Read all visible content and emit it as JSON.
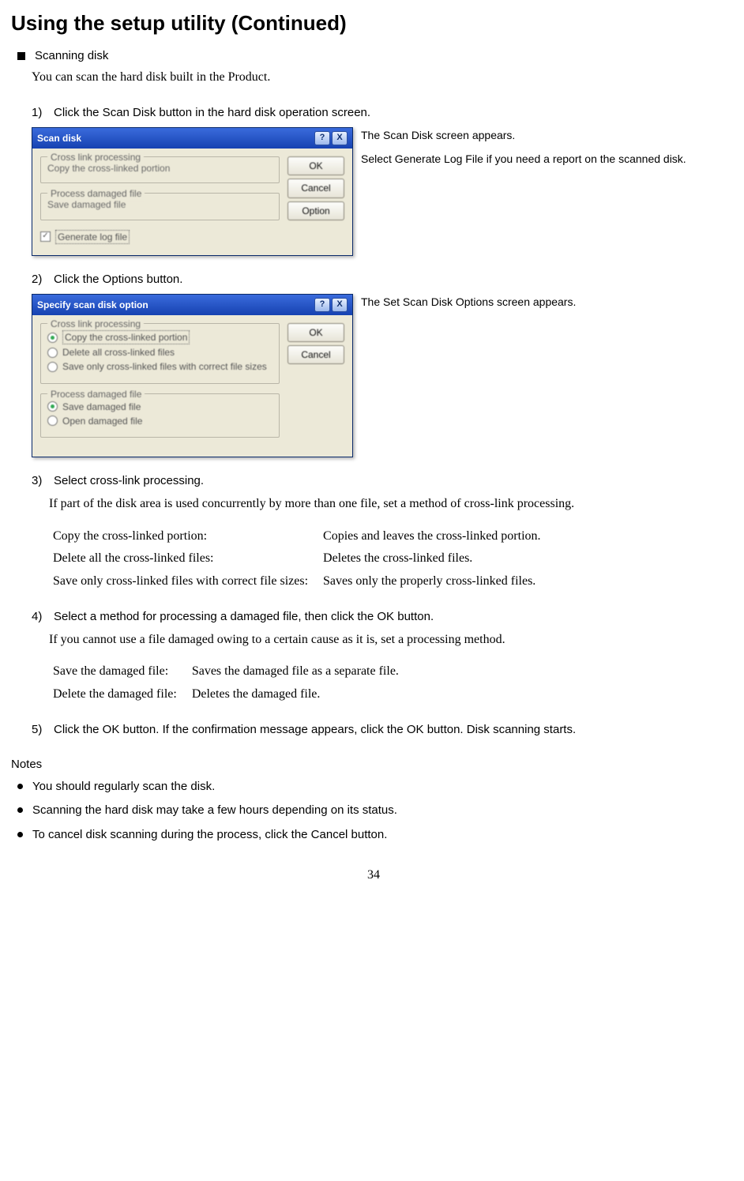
{
  "title": "Using the setup utility (Continued)",
  "section": "Scanning disk",
  "intro": "You can scan the hard disk built in the Product.",
  "steps": {
    "s1": {
      "num": "1)",
      "text": "Click the Scan Disk button in the hard disk operation screen."
    },
    "s2": {
      "num": "2)",
      "text": "Click the Options button."
    },
    "s3": {
      "num": "3)",
      "text": "Select cross-link processing.",
      "body": "If part of the disk area is used concurrently by more than one file, set a method of cross-link processing."
    },
    "s4": {
      "num": "4)",
      "text": "Select a method for processing a damaged file, then click the OK button.",
      "body": "If you cannot use a file damaged owing to a certain cause as it is, set a processing method."
    },
    "s5": {
      "num": "5)",
      "text": "Click the OK button.  If the confirmation message appears, click the OK button.  Disk scanning starts."
    }
  },
  "fig1": {
    "title": "Scan disk",
    "help": "?",
    "close": "X",
    "grp1_title": "Cross link processing",
    "grp1_line": "Copy the cross-linked portion",
    "grp2_title": "Process damaged file",
    "grp2_line": "Save damaged file",
    "check_label": "Generate log file",
    "btn_ok": "OK",
    "btn_cancel": "Cancel",
    "btn_option": "Option",
    "cap1": "The Scan Disk screen appears.",
    "cap2": "Select Generate Log File if you need a report on the scanned disk."
  },
  "fig2": {
    "title": "Specify scan disk option",
    "help": "?",
    "close": "X",
    "grp1_title": "Cross link processing",
    "r1": "Copy the cross-linked portion",
    "r2": "Delete all cross-linked files",
    "r3": "Save only cross-linked files with correct file sizes",
    "grp2_title": "Process damaged file",
    "r4": "Save damaged file",
    "r5": "Open damaged file",
    "btn_ok": "OK",
    "btn_cancel": "Cancel",
    "cap1": "The Set Scan Disk Options screen appears."
  },
  "opts3": {
    "a_l": "Copy the cross-linked portion:",
    "a_r": "Copies and leaves the cross-linked portion.",
    "b_l": "Delete all the cross-linked files:",
    "b_r": "Deletes the cross-linked files.",
    "c_l": "Save only cross-linked files with correct file sizes:",
    "c_r": "Saves only the properly cross-linked files."
  },
  "opts4": {
    "a_l": "Save the damaged file:",
    "a_r": "Saves the damaged file as a separate file.",
    "b_l": "Delete the damaged file:",
    "b_r": "Deletes the damaged file."
  },
  "notes_h": "Notes",
  "notes": {
    "n1": "You should regularly scan the disk.",
    "n2": "Scanning the hard disk may take a few hours depending on its status.",
    "n3": "To cancel disk scanning during the process, click the Cancel button."
  },
  "page": "34"
}
